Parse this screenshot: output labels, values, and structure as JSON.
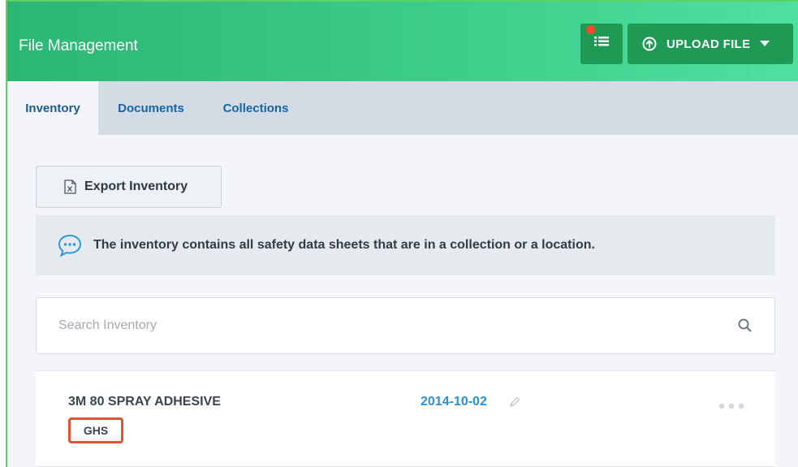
{
  "header": {
    "title": "File Management",
    "upload_label": "UPLOAD FILE"
  },
  "tabs": [
    {
      "label": "Inventory",
      "active": true
    },
    {
      "label": "Documents",
      "active": false
    },
    {
      "label": "Collections",
      "active": false
    }
  ],
  "toolbar": {
    "export_label": "Export Inventory"
  },
  "info": {
    "message": "The inventory contains all safety data sheets that are in a collection or a location."
  },
  "search": {
    "placeholder": "Search Inventory",
    "value": ""
  },
  "items": [
    {
      "name": "3M 80 SPRAY ADHESIVE",
      "badge": "GHS",
      "date": "2014-10-02"
    }
  ],
  "colors": {
    "header_gradient_start": "#2bb673",
    "header_gradient_end": "#4fe0a0",
    "button_dark_green": "#1e9a55",
    "notification_dot": "#f04a2a",
    "tab_text": "#1565a6",
    "date_link": "#2d8fd1",
    "badge_border": "#e05236"
  },
  "icons": {
    "list": "list-icon",
    "upload": "upload-circle-icon",
    "caret": "caret-down-icon",
    "export": "excel-file-icon",
    "info": "chat-bubble-icon",
    "search": "search-icon",
    "edit": "pencil-icon",
    "more": "more-dots-icon"
  }
}
